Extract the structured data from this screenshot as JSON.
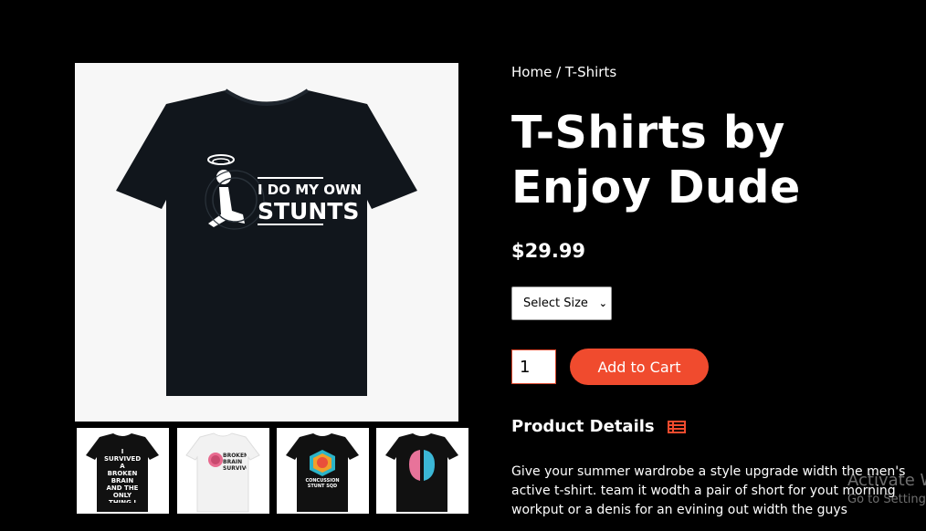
{
  "breadcrumb": {
    "home": "Home",
    "separator": " / ",
    "current": "T-Shirts"
  },
  "product": {
    "title": "T-Shirts by Enjoy Dude",
    "price": "$29.99",
    "main_image_text_line1": "I DO MY OWN",
    "main_image_text_line2": "STUNTS"
  },
  "size_select": {
    "selected": "Select Size",
    "icon": "chevron-down-icon"
  },
  "quantity": {
    "value": "1"
  },
  "cart": {
    "add_label": "Add to Cart",
    "accent_color": "#f04b2e"
  },
  "details": {
    "heading": "Product Details",
    "icon": "list-icon",
    "description": "Give your summer wardrobe a style upgrade width the men's active t-shirt. team it wodth a pair of short for yout morning workput or a denis for an evining out width the guys"
  },
  "thumbnails": [
    {
      "text": "I SURVIVED A BROKEN BRAIN AND THE ONLY THING I GOT WAS THIS SHIRT",
      "shirt_color": "#111111"
    },
    {
      "text": "BROKEN BRAIN SURVIVOR",
      "shirt_color": "#f2f2f2"
    },
    {
      "text": "CONCUSSION STUNT SQD",
      "shirt_color": "#111111"
    },
    {
      "text": "",
      "shirt_color": "#111111"
    }
  ],
  "watermark": {
    "line1": "Activate W",
    "line2": "Go to Setting"
  }
}
